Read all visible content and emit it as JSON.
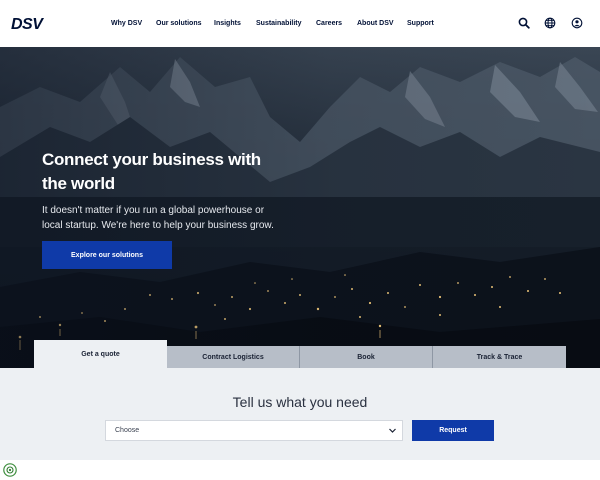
{
  "header": {
    "logo_text": "DSV",
    "nav": [
      {
        "label": "Why DSV"
      },
      {
        "label": "Our solutions"
      },
      {
        "label": "Insights"
      },
      {
        "label": "Sustainability"
      },
      {
        "label": "Careers"
      },
      {
        "label": "About DSV"
      },
      {
        "label": "Support"
      }
    ],
    "icons": [
      "search-icon",
      "globe-icon",
      "user-icon"
    ]
  },
  "hero": {
    "title": "Connect your business with the world",
    "subtitle": "It doesn't matter if you run a global powerhouse or local startup. We're here to help your business grow.",
    "cta_label": "Explore our solutions"
  },
  "tabs": [
    {
      "label": "Get a quote",
      "active": true
    },
    {
      "label": "Contract Logistics",
      "active": false
    },
    {
      "label": "Book",
      "active": false
    },
    {
      "label": "Track & Trace",
      "active": false
    }
  ],
  "quote": {
    "title": "Tell us what you need",
    "select_value": "Choose",
    "request_label": "Request"
  },
  "colors": {
    "brand_navy": "#001035",
    "brand_blue": "#0f3aa8",
    "panel_bg": "#edf0f3",
    "tab_inactive": "#b7bec8"
  }
}
